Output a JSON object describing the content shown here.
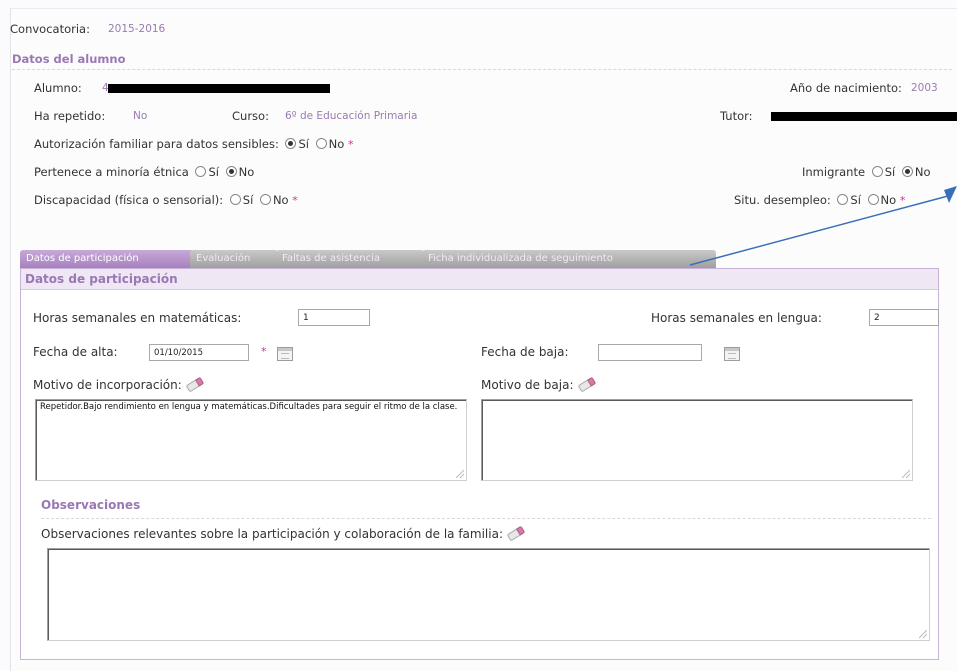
{
  "header": {
    "convocatoria_label": "Convocatoria:",
    "convocatoria_value": "2015-2016"
  },
  "alumno_section": {
    "title": "Datos del alumno",
    "alumno_label": "Alumno:",
    "alumno_value_prefix": "4",
    "anio_label": "Año de nacimiento:",
    "anio_value": "2003",
    "ha_repetido_label": "Ha repetido:",
    "ha_repetido_value": "No",
    "curso_label": "Curso:",
    "curso_value": "6º de Educación Primaria",
    "tutor_label": "Tutor:",
    "autorizacion_label": "Autorización familiar para datos sensibles:",
    "autorizacion_si": "Sí",
    "autorizacion_no": "No",
    "minoria_label": "Pertenece a minoría étnica",
    "minoria_si": "Sí",
    "minoria_no": "No",
    "inmigrante_label": "Inmigrante",
    "inmigrante_si": "Sí",
    "inmigrante_no": "No",
    "discapacidad_label": "Discapacidad (física o sensorial):",
    "discapacidad_si": "Sí",
    "discapacidad_no": "No",
    "desempleo_label": "Situ. desempleo:",
    "desempleo_si": "Sí",
    "desempleo_no": "No",
    "required_mark": "*"
  },
  "tabs": [
    {
      "label": "Datos de participación",
      "active": true
    },
    {
      "label": "Evaluación",
      "active": false
    },
    {
      "label": "Faltas de asistencia",
      "active": false
    },
    {
      "label": "Ficha individualizada de seguimiento",
      "active": false
    }
  ],
  "participacion": {
    "title": "Datos de participación",
    "horas_mat_label": "Horas semanales en matemáticas:",
    "horas_mat_value": "1",
    "horas_len_label": "Horas semanales en lengua:",
    "horas_len_value": "2",
    "fecha_alta_label": "Fecha de alta:",
    "fecha_alta_value": "01/10/2015",
    "fecha_baja_label": "Fecha de baja:",
    "fecha_baja_value": "",
    "motivo_inc_label": "Motivo de incorporación:",
    "motivo_inc_value": "Repetidor.Bajo rendimiento en lengua y matemáticas.Dificultades para seguir el ritmo de la clase.",
    "motivo_baja_label": "Motivo de baja:",
    "motivo_baja_value": ""
  },
  "observaciones": {
    "title": "Observaciones",
    "familia_label": "Observaciones relevantes sobre la participación y colaboración de la familia:",
    "familia_value": ""
  },
  "colors": {
    "accent": "#9a78b4",
    "tab_active": "#a681be",
    "tab_inactive": "#a8a8a8",
    "annotation_arrow": "#3a6fb8",
    "required": "#c0398f"
  },
  "icons": [
    "calendar-icon",
    "pencil-eraser-icon",
    "resize-grip-icon"
  ]
}
